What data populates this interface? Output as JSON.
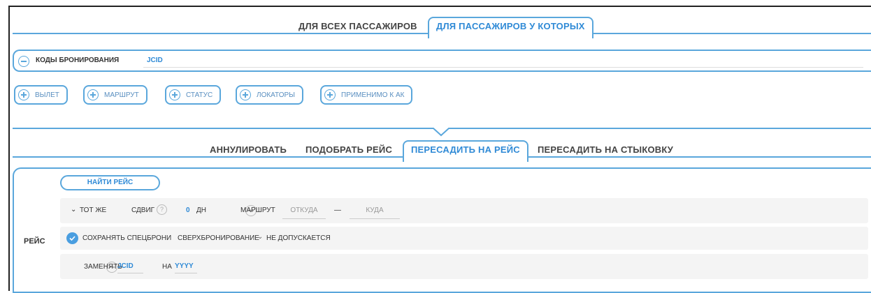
{
  "top_tabs": {
    "all_passengers": "ДЛЯ ВСЕХ ПАССАЖИРОВ",
    "passengers_which": "ДЛЯ ПАССАЖИРОВ У КОТОРЫХ"
  },
  "booking_codes": {
    "label": "КОДЫ БРОНИРОВАНИЯ",
    "value": "JCID"
  },
  "filters": [
    "ВЫЛЕТ",
    "МАРШРУТ",
    "СТАТУС",
    "ЛОКАТОРЫ",
    "ПРИМЕНИМО К АК"
  ],
  "action_tabs": {
    "cancel": "АННУЛИРОВАТЬ",
    "pick_flight": "ПОДОБРАТЬ РЕЙС",
    "rebook_flight": "ПЕРЕСАДИТЬ НА РЕЙС",
    "rebook_connection": "ПЕРЕСАДИТЬ НА СТЫКОВКУ"
  },
  "flight": {
    "section_label": "РЕЙС",
    "find_button": "НАЙТИ РЕЙС",
    "same_label": "ТОТ ЖЕ",
    "shift_label": "СДВИГ",
    "help": "?",
    "shift_value": "0",
    "days_label": "ДН",
    "route_label": "МАРШРУТ",
    "from_placeholder": "ОТКУДА",
    "dash": "—",
    "to_placeholder": "КУДА",
    "keep_special": "СОХРАНЯТЬ СПЕЦБРОНИ",
    "overbooking_label": "СВЕРХБРОНИРОВАНИЕ",
    "overbooking_value": "НЕ ДОПУСКАЕТСЯ",
    "replace_label": "ЗАМЕНЯТЬ",
    "replace_from": "JCID",
    "replace_on": "НА",
    "replace_to": "YYYY"
  },
  "colors": {
    "accent": "#2f8ad6",
    "border": "#5aa7dc"
  }
}
